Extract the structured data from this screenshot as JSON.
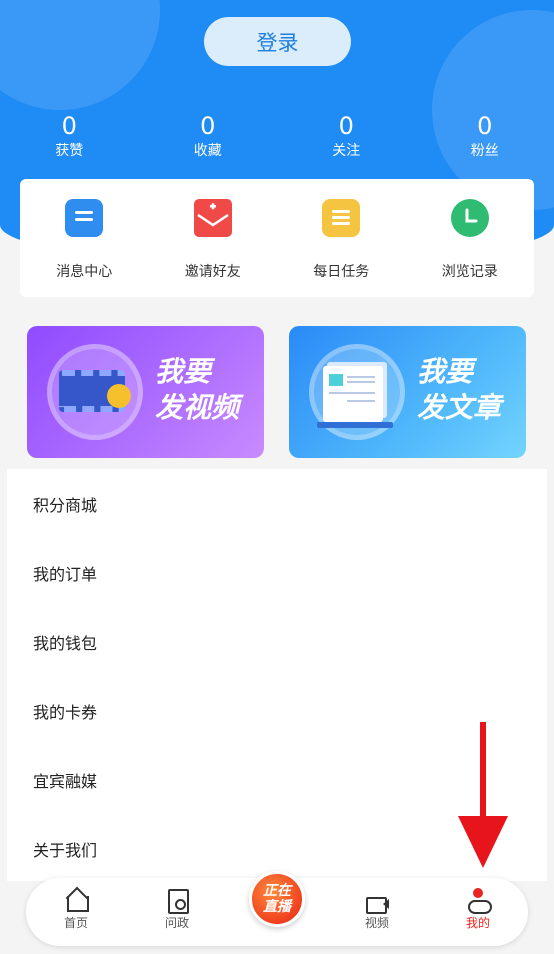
{
  "header": {
    "login_label": "登录",
    "bg_color": "#1f8bf5",
    "stats": [
      {
        "value": "0",
        "label": "获赞"
      },
      {
        "value": "0",
        "label": "收藏"
      },
      {
        "value": "0",
        "label": "关注"
      },
      {
        "value": "0",
        "label": "粉丝"
      }
    ]
  },
  "quick_actions": [
    {
      "label": "消息中心",
      "icon": "message-icon"
    },
    {
      "label": "邀请好友",
      "icon": "invite-icon"
    },
    {
      "label": "每日任务",
      "icon": "task-icon"
    },
    {
      "label": "浏览记录",
      "icon": "history-clock-icon"
    }
  ],
  "banners": {
    "video": {
      "line1": "我要",
      "line2": "发视频"
    },
    "article": {
      "line1": "我要",
      "line2": "发文章"
    }
  },
  "menu": [
    {
      "label": "积分商城"
    },
    {
      "label": "我的订单"
    },
    {
      "label": "我的钱包"
    },
    {
      "label": "我的卡券"
    },
    {
      "label": "宜宾融媒"
    },
    {
      "label": "关于我们"
    }
  ],
  "tabbar": {
    "home": "首页",
    "ask": "问政",
    "live_line1": "正在",
    "live_line2": "直播",
    "video": "视频",
    "mine": "我的",
    "active_color": "#e8251e"
  }
}
